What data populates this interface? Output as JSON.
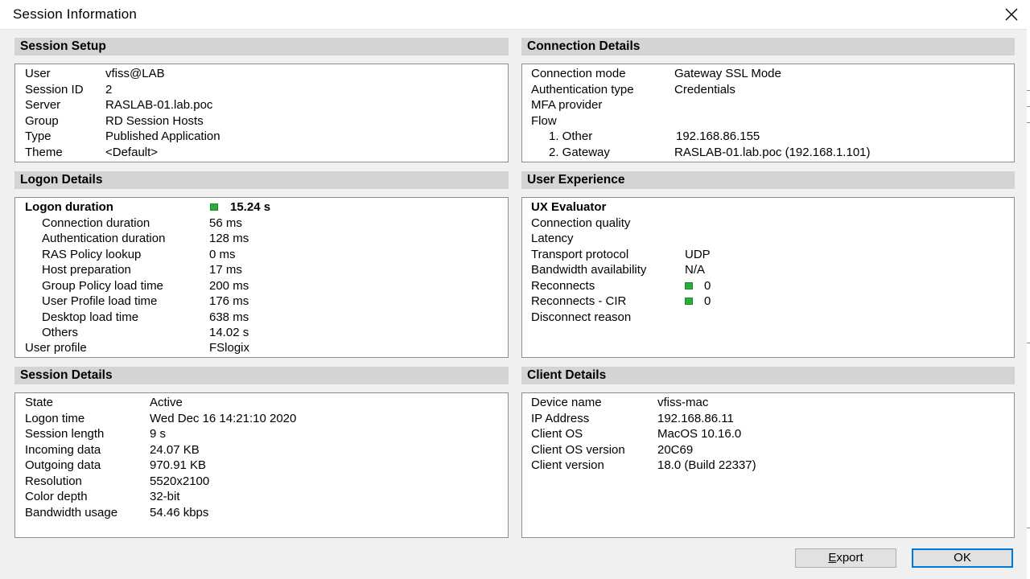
{
  "window": {
    "title": "Session Information"
  },
  "sections": {
    "session_setup": {
      "title": "Session Setup",
      "rows": [
        {
          "label": "User",
          "value": "vfiss@LAB"
        },
        {
          "label": "Session ID",
          "value": "2"
        },
        {
          "label": "Server",
          "value": "RASLAB-01.lab.poc"
        },
        {
          "label": "Group",
          "value": "RD Session Hosts"
        },
        {
          "label": "Type",
          "value": "Published Application"
        },
        {
          "label": "Theme",
          "value": "<Default>"
        }
      ]
    },
    "connection_details": {
      "title": "Connection Details",
      "rows": [
        {
          "label": "Connection mode",
          "value": "Gateway SSL Mode"
        },
        {
          "label": "Authentication type",
          "value": "Credentials"
        },
        {
          "label": "MFA provider",
          "value": ""
        },
        {
          "label": "Flow",
          "value": ""
        },
        {
          "label": "1. Other",
          "value": "192.168.86.155"
        },
        {
          "label": "2. Gateway",
          "value": "RASLAB-01.lab.poc (192.168.1.101)"
        }
      ]
    },
    "logon_details": {
      "title": "Logon Details",
      "total": {
        "label": "Logon duration",
        "value": "15.24 s",
        "status_color": "#2bab3a"
      },
      "rows": [
        {
          "label": "Connection duration",
          "value": "56 ms"
        },
        {
          "label": "Authentication duration",
          "value": "128 ms"
        },
        {
          "label": "RAS Policy lookup",
          "value": "0 ms"
        },
        {
          "label": "Host preparation",
          "value": "17 ms"
        },
        {
          "label": "Group Policy load time",
          "value": "200 ms"
        },
        {
          "label": "User Profile load time",
          "value": "176 ms"
        },
        {
          "label": "Desktop load time",
          "value": "638 ms"
        },
        {
          "label": "Others",
          "value": "14.02 s"
        }
      ],
      "profile": {
        "label": "User profile",
        "value": "FSlogix"
      }
    },
    "user_experience": {
      "title": "User Experience",
      "heading": "UX Evaluator",
      "rows": [
        {
          "label": "Connection quality",
          "value": ""
        },
        {
          "label": "Latency",
          "value": ""
        },
        {
          "label": "Transport protocol",
          "value": "UDP"
        },
        {
          "label": "Bandwidth availability",
          "value": "N/A"
        },
        {
          "label": "Reconnects",
          "value": "0",
          "status_color": "#2bab3a"
        },
        {
          "label": "Reconnects - CIR",
          "value": "0",
          "status_color": "#2bab3a"
        },
        {
          "label": "Disconnect reason",
          "value": ""
        }
      ]
    },
    "session_details": {
      "title": "Session Details",
      "rows": [
        {
          "label": "State",
          "value": "Active"
        },
        {
          "label": "Logon time",
          "value": "Wed Dec 16 14:21:10 2020"
        },
        {
          "label": "Session length",
          "value": "9 s"
        },
        {
          "label": "Incoming data",
          "value": "24.07 KB"
        },
        {
          "label": "Outgoing data",
          "value": "970.91 KB"
        },
        {
          "label": "Resolution",
          "value": "5520x2100"
        },
        {
          "label": "Color depth",
          "value": "32-bit"
        },
        {
          "label": "Bandwidth usage",
          "value": "54.46 kbps"
        }
      ]
    },
    "client_details": {
      "title": "Client Details",
      "rows": [
        {
          "label": "Device name",
          "value": "vfiss-mac"
        },
        {
          "label": "IP Address",
          "value": "192.168.86.11"
        },
        {
          "label": "Client OS",
          "value": "MacOS 10.16.0"
        },
        {
          "label": "Client OS version",
          "value": "20C69"
        },
        {
          "label": "Client version",
          "value": "18.0 (Build 22337)"
        }
      ]
    }
  },
  "buttons": {
    "export": {
      "label": "Export",
      "mnemonic": "E",
      "rest": "xport"
    },
    "ok": {
      "label": "OK"
    }
  }
}
